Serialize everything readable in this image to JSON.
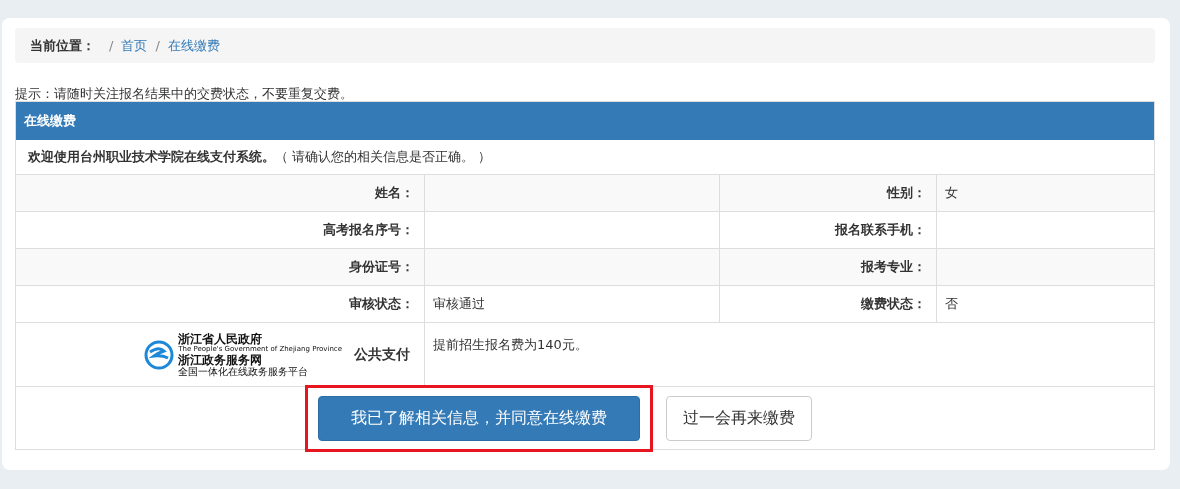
{
  "breadcrumb": {
    "label": "当前位置：",
    "items": [
      {
        "separator": "/",
        "text": "首页"
      },
      {
        "separator": "/",
        "text": "在线缴费"
      }
    ]
  },
  "hint": "提示：请随时关注报名结果中的交费状态，不要重复交费。",
  "panel": {
    "title": "在线缴费",
    "welcome": "欢迎使用台州职业技术学院在线支付系统。",
    "welcome_note": "（ 请确认您的相关信息是否正确。 ）",
    "rows": [
      {
        "cells": [
          {
            "label": "姓名："
          },
          {
            "label": "性别：",
            "value": "女"
          }
        ]
      },
      {
        "cells": [
          {
            "label": "高考报名序号："
          },
          {
            "label": "报名联系手机："
          }
        ]
      },
      {
        "cells": [
          {
            "label": "身份证号："
          },
          {
            "label": "报考专业："
          }
        ]
      },
      {
        "cells": [
          {
            "label": "审核状态：",
            "value": "审核通过"
          },
          {
            "label": "缴费状态：",
            "value": "否"
          }
        ]
      }
    ],
    "payment": {
      "logo_lines": [
        "浙江省人民政府",
        "The People's Government of Zhejiang Province",
        "浙江政务服务网",
        "全国一体化在线政务服务平台"
      ],
      "logo_tag": "公共支付",
      "note": "提前招生报名费为140元。"
    },
    "buttons": [
      {
        "label": "我已了解相关信息，并同意在线缴费",
        "kind": "primary",
        "highlighted": true
      },
      {
        "label": "过一会再来缴费",
        "kind": "default",
        "highlighted": false
      }
    ]
  }
}
